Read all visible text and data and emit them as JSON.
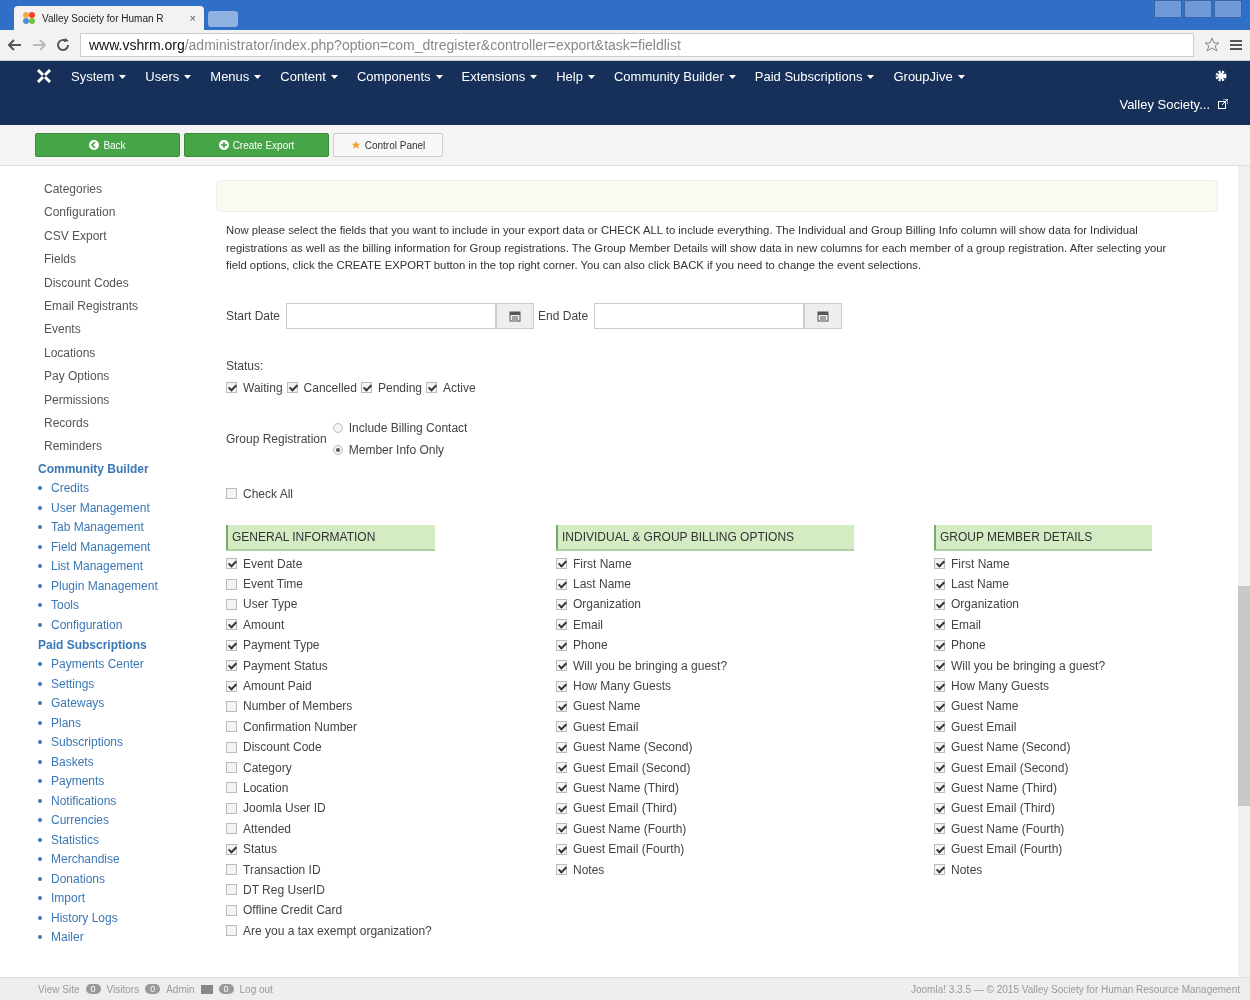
{
  "browser": {
    "tab_title": "Valley Society for Human R",
    "close": "×",
    "url_host": "www.vshrm.org",
    "url_path": "/administrator/index.php?option=com_dtregister&controller=export&task=fieldlist"
  },
  "nav": {
    "menus": [
      "System",
      "Users",
      "Menus",
      "Content",
      "Components",
      "Extensions",
      "Help",
      "Community Builder",
      "Paid Subscriptions",
      "GroupJive"
    ],
    "user": "Valley Society..."
  },
  "toolbar": [
    {
      "label": "Back",
      "kind": "success"
    },
    {
      "label": "Create Export",
      "kind": "success"
    },
    {
      "label": "Control Panel",
      "kind": "default"
    }
  ],
  "sidebar": {
    "items": [
      "Categories",
      "Configuration",
      "CSV Export",
      "Fields",
      "Discount Codes",
      "Email Registrants",
      "Events",
      "Locations",
      "Pay Options",
      "Permissions",
      "Records",
      "Reminders"
    ],
    "sections": [
      {
        "title": "Community Builder",
        "items": [
          "Credits",
          "User Management",
          "Tab Management",
          "Field Management",
          "List Management",
          "Plugin Management",
          "Tools",
          "Configuration"
        ]
      },
      {
        "title": "Paid Subscriptions",
        "items": [
          "Payments Center",
          "Settings",
          "Gateways",
          "Plans",
          "Subscriptions",
          "Baskets",
          "Payments",
          "Notifications",
          "Currencies",
          "Statistics",
          "Merchandise",
          "Donations",
          "Import",
          "History Logs",
          "Mailer"
        ]
      }
    ]
  },
  "intro": "Now please select the fields that you want to include in your export data or CHECK ALL to include everything. The Individual and Group Billing Info column will show data for Individual registrations as well as the billing information for Group registrations. The Group Member Details will show data in new columns for each member of a group registration. After selecting your field options, click the CREATE EXPORT button in the top right corner. You can also click BACK if you need to change the event selections.",
  "start_date": {
    "label": "Start Date"
  },
  "end_date": {
    "label": "End Date"
  },
  "status": {
    "label": "Status:",
    "options": [
      {
        "label": "Waiting",
        "checked": true
      },
      {
        "label": "Cancelled",
        "checked": true
      },
      {
        "label": "Pending",
        "checked": true
      },
      {
        "label": "Active",
        "checked": true
      }
    ]
  },
  "group_registration": {
    "label": "Group Registration",
    "options": [
      {
        "label": "Include Billing Contact",
        "selected": false
      },
      {
        "label": "Member Info Only",
        "selected": true
      }
    ]
  },
  "check_all": {
    "label": "Check All",
    "checked": false
  },
  "columns": [
    {
      "title": "GENERAL INFORMATION",
      "fields": [
        {
          "label": "Event Date",
          "checked": true
        },
        {
          "label": "Event Time",
          "checked": false
        },
        {
          "label": "User Type",
          "checked": false
        },
        {
          "label": "Amount",
          "checked": true
        },
        {
          "label": "Payment Type",
          "checked": true
        },
        {
          "label": "Payment Status",
          "checked": true
        },
        {
          "label": "Amount Paid",
          "checked": true
        },
        {
          "label": "Number of Members",
          "checked": false
        },
        {
          "label": "Confirmation Number",
          "checked": false
        },
        {
          "label": "Discount Code",
          "checked": false
        },
        {
          "label": "Category",
          "checked": false
        },
        {
          "label": "Location",
          "checked": false
        },
        {
          "label": "Joomla User ID",
          "checked": false
        },
        {
          "label": "Attended",
          "checked": false
        },
        {
          "label": "Status",
          "checked": true
        },
        {
          "label": "Transaction ID",
          "checked": false
        },
        {
          "label": "DT Reg UserID",
          "checked": false
        },
        {
          "label": "Offline Credit Card",
          "checked": false
        },
        {
          "label": "Are you a tax exempt organization?",
          "checked": false
        }
      ]
    },
    {
      "title": "INDIVIDUAL & GROUP BILLING OPTIONS",
      "fields": [
        {
          "label": "First Name",
          "checked": true
        },
        {
          "label": "Last Name",
          "checked": true
        },
        {
          "label": "Organization",
          "checked": true
        },
        {
          "label": "Email",
          "checked": true
        },
        {
          "label": "Phone",
          "checked": true
        },
        {
          "label": "Will you be bringing a guest?",
          "checked": true
        },
        {
          "label": "How Many Guests",
          "checked": true
        },
        {
          "label": "Guest Name",
          "checked": true
        },
        {
          "label": "Guest Email",
          "checked": true
        },
        {
          "label": "Guest Name (Second)",
          "checked": true
        },
        {
          "label": "Guest Email (Second)",
          "checked": true
        },
        {
          "label": "Guest Name (Third)",
          "checked": true
        },
        {
          "label": "Guest Email (Third)",
          "checked": true
        },
        {
          "label": "Guest Name (Fourth)",
          "checked": true
        },
        {
          "label": "Guest Email (Fourth)",
          "checked": true
        },
        {
          "label": "Notes",
          "checked": true
        }
      ]
    },
    {
      "title": "GROUP MEMBER DETAILS",
      "fields": [
        {
          "label": "First Name",
          "checked": true
        },
        {
          "label": "Last Name",
          "checked": true
        },
        {
          "label": "Organization",
          "checked": true
        },
        {
          "label": "Email",
          "checked": true
        },
        {
          "label": "Phone",
          "checked": true
        },
        {
          "label": "Will you be bringing a guest?",
          "checked": true
        },
        {
          "label": "How Many Guests",
          "checked": true
        },
        {
          "label": "Guest Name",
          "checked": true
        },
        {
          "label": "Guest Email",
          "checked": true
        },
        {
          "label": "Guest Name (Second)",
          "checked": true
        },
        {
          "label": "Guest Email (Second)",
          "checked": true
        },
        {
          "label": "Guest Name (Third)",
          "checked": true
        },
        {
          "label": "Guest Email (Third)",
          "checked": true
        },
        {
          "label": "Guest Name (Fourth)",
          "checked": true
        },
        {
          "label": "Guest Email (Fourth)",
          "checked": true
        },
        {
          "label": "Notes",
          "checked": true
        }
      ]
    }
  ],
  "footer": {
    "view_site": "View Site",
    "visitors_count": "0",
    "visitors": "Visitors",
    "admin_count": "0",
    "admin": "Admin",
    "messages_count": "0",
    "logout": "Log out",
    "copyright": "Joomla! 3.3.5 — © 2015 Valley Society for Human Resource Management"
  }
}
